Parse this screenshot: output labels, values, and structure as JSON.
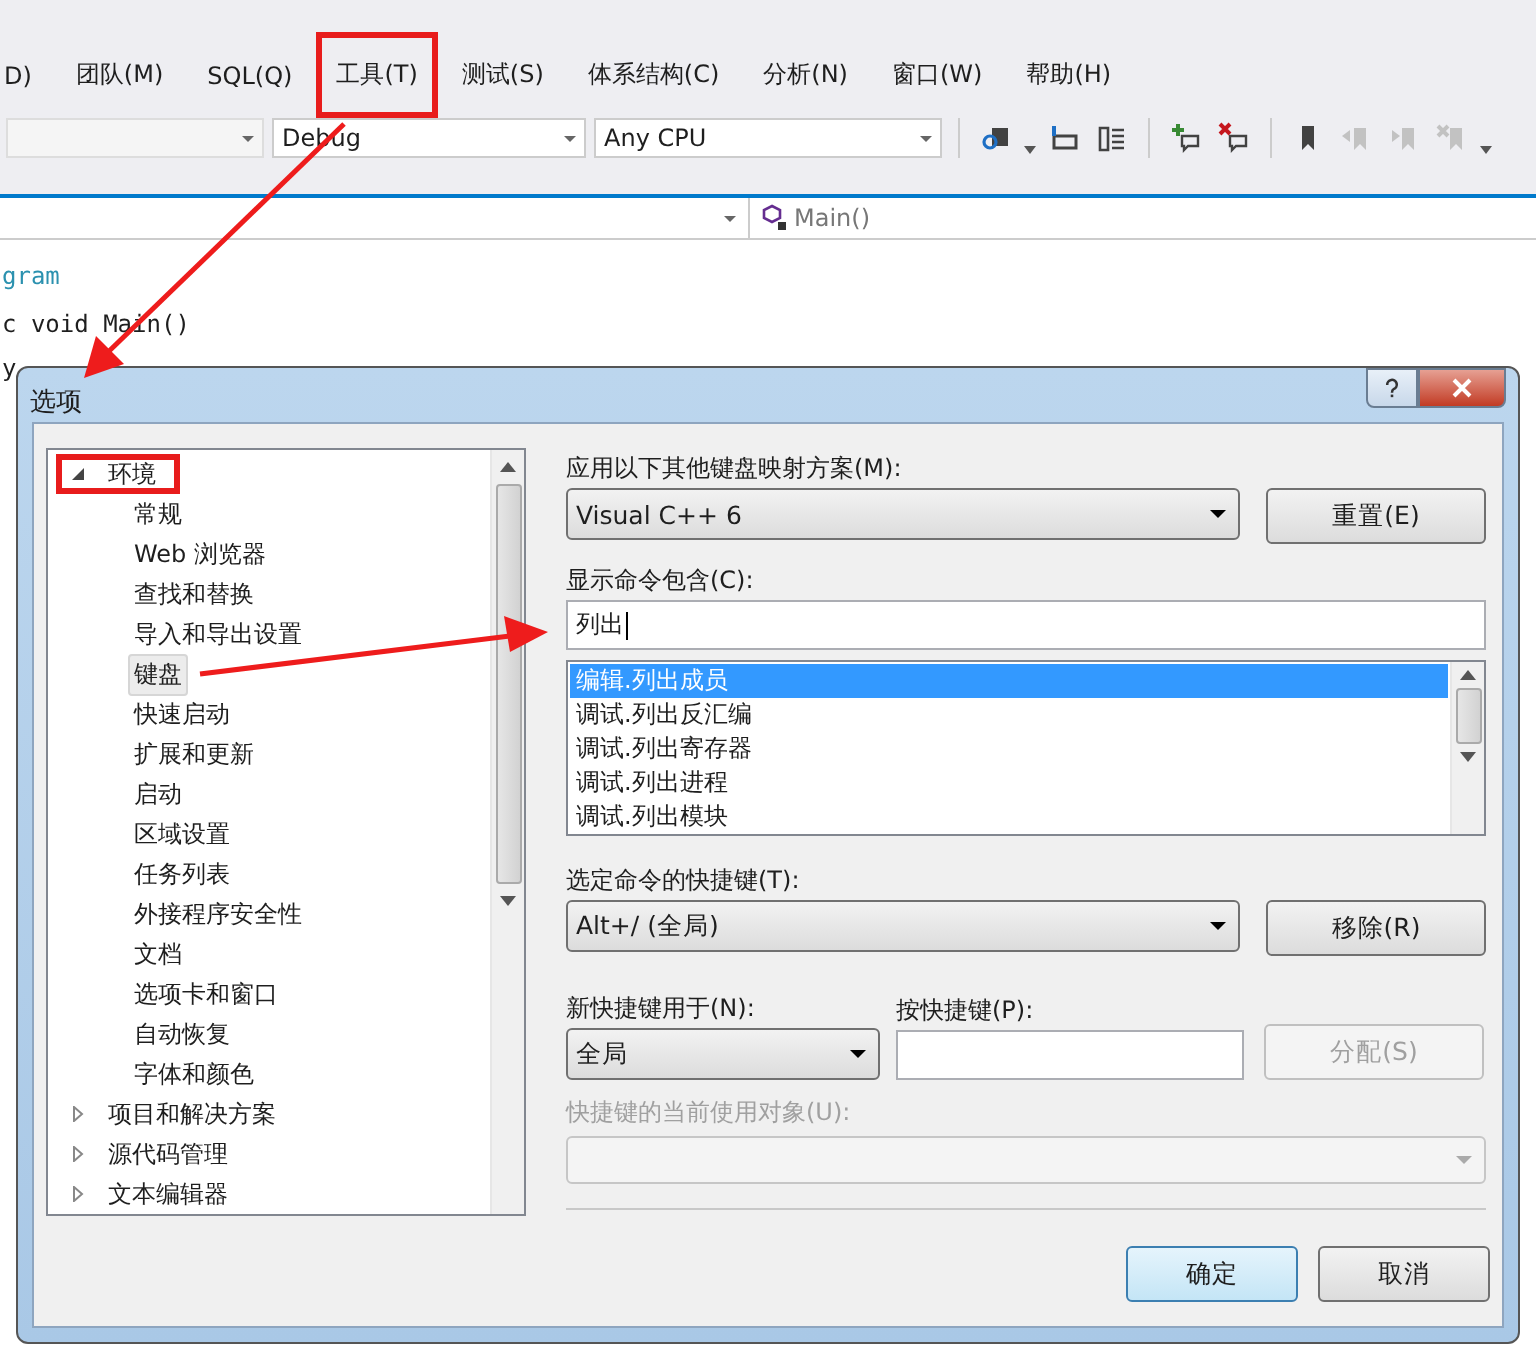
{
  "menu": [
    {
      "label": "D)",
      "highlighted": false
    },
    {
      "label": "团队(M)",
      "highlighted": false
    },
    {
      "label": "SQL(Q)",
      "highlighted": false
    },
    {
      "label": "工具(T)",
      "highlighted": true
    },
    {
      "label": "测试(S)",
      "highlighted": false
    },
    {
      "label": "体系结构(C)",
      "highlighted": false
    },
    {
      "label": "分析(N)",
      "highlighted": false
    },
    {
      "label": "窗口(W)",
      "highlighted": false
    },
    {
      "label": "帮助(H)",
      "highlighted": false
    }
  ],
  "toolbar": {
    "combos": [
      {
        "disabled": true
      },
      {
        "value": "Debug",
        "disabled": false
      },
      {
        "value": "Any CPU",
        "disabled": false
      }
    ]
  },
  "navbar": {
    "member": "Main()"
  },
  "code": [
    "gram",
    "c void Main()",
    "y"
  ],
  "dialog": {
    "title": "选项",
    "tree": [
      {
        "label": "环境",
        "expanded": true,
        "selected": false,
        "highlighted": true,
        "children": [
          {
            "label": "常规",
            "selected": false
          },
          {
            "label": "Web 浏览器",
            "selected": false
          },
          {
            "label": "查找和替换",
            "selected": false
          },
          {
            "label": "导入和导出设置",
            "selected": false
          },
          {
            "label": "键盘",
            "selected": true
          },
          {
            "label": "快速启动",
            "selected": false
          },
          {
            "label": "扩展和更新",
            "selected": false
          },
          {
            "label": "启动",
            "selected": false
          },
          {
            "label": "区域设置",
            "selected": false
          },
          {
            "label": "任务列表",
            "selected": false
          },
          {
            "label": "外接程序安全性",
            "selected": false
          },
          {
            "label": "文档",
            "selected": false
          },
          {
            "label": "选项卡和窗口",
            "selected": false
          },
          {
            "label": "自动恢复",
            "selected": false
          },
          {
            "label": "字体和颜色",
            "selected": false
          }
        ]
      },
      {
        "label": "项目和解决方案",
        "expanded": false,
        "selected": false,
        "highlighted": false
      },
      {
        "label": "源代码管理",
        "expanded": false,
        "selected": false,
        "highlighted": false
      },
      {
        "label": "文本编辑器",
        "expanded": false,
        "selected": false,
        "highlighted": false
      }
    ],
    "scheme_label": "应用以下其他键盘映射方案(M):",
    "scheme_value": "Visual C++ 6",
    "reset_button": "重置(E)",
    "filter_label": "显示命令包含(C):",
    "filter_value": "列出",
    "commands": [
      {
        "label": "编辑.列出成员",
        "selected": true
      },
      {
        "label": "调试.列出反汇编",
        "selected": false
      },
      {
        "label": "调试.列出寄存器",
        "selected": false
      },
      {
        "label": "调试.列出进程",
        "selected": false
      },
      {
        "label": "调试.列出模块",
        "selected": false
      }
    ],
    "shortcut_label": "选定命令的快捷键(T):",
    "shortcut_value": "Alt+/ (全局)",
    "remove_button": "移除(R)",
    "scope_label": "新快捷键用于(N):",
    "scope_value": "全局",
    "press_label": "按快捷键(P):",
    "assign_button": {
      "label": "分配(S)",
      "disabled": true
    },
    "usedby_label": {
      "label": "快捷键的当前使用对象(U):",
      "disabled": true
    },
    "ok_button": "确定",
    "cancel_button": "取消"
  }
}
